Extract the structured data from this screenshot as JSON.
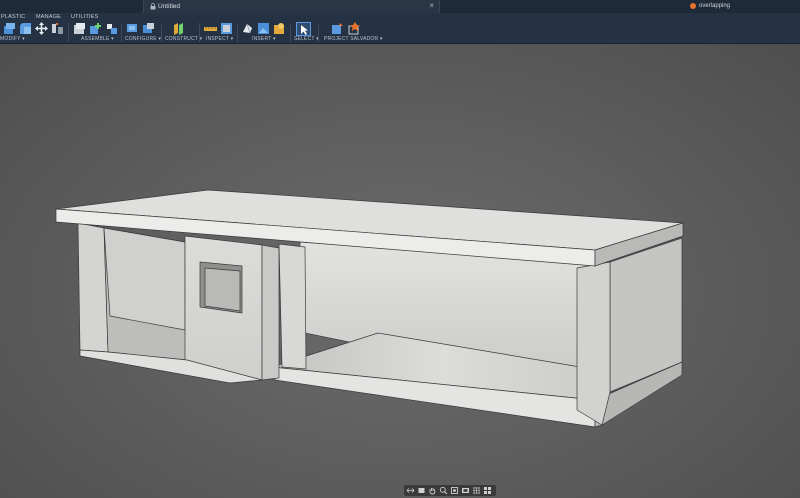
{
  "window": {
    "document_title": "Untitled",
    "close_glyph": "×",
    "user_name": "overlapping"
  },
  "toolbar": {
    "tabs": [
      "PLASTIC",
      "MANAGE",
      "UTILITIES"
    ],
    "groups": [
      {
        "label": "MODIFY ▾",
        "icons": [
          "press-pull-icon",
          "fillet-icon",
          "move-icon",
          "align-icon"
        ]
      },
      {
        "label": "ASSEMBLE ▾",
        "icons": [
          "new-component-icon",
          "joint-icon",
          "as-built-joint-icon"
        ]
      },
      {
        "label": "CONFIGURE ▾",
        "icons": [
          "configure-icon",
          "configure-table-icon"
        ]
      },
      {
        "label": "CONSTRUCT ▾",
        "icons": [
          "offset-plane-icon"
        ]
      },
      {
        "label": "INSPECT ▾",
        "icons": [
          "measure-icon",
          "section-analysis-icon"
        ]
      },
      {
        "label": "INSERT ▾",
        "icons": [
          "insert-mesh-icon",
          "decal-icon",
          "canvas-icon"
        ]
      },
      {
        "label": "SELECT ▾",
        "icons": [
          "select-icon"
        ]
      },
      {
        "label": "PROJECT SALVADOR ▾",
        "icons": [
          "salvador-icon-1",
          "salvador-icon-2"
        ]
      }
    ]
  },
  "navbar": {
    "icons": [
      "orbit-icon",
      "look-at-icon",
      "pan-icon",
      "zoom-icon",
      "fit-icon",
      "display-settings-icon",
      "grid-icon",
      "viewports-icon"
    ]
  },
  "colors": {
    "titlebar": "#1e2a38",
    "toolbar": "#253244",
    "viewport": "#5b5b5b",
    "model": "#d6d6d6",
    "accent": "#5a9ae0"
  }
}
